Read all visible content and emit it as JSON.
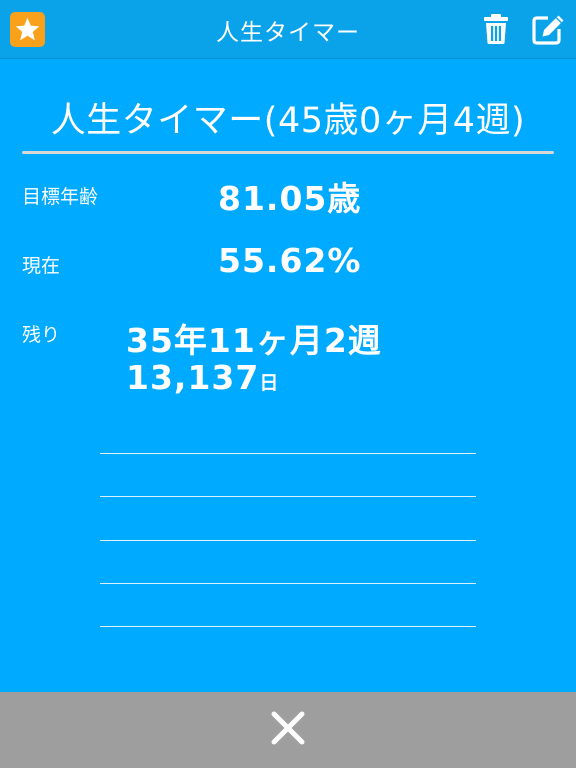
{
  "navbar": {
    "title": "人生タイマー",
    "favorite_icon": "star-icon",
    "delete_icon": "trash-icon",
    "edit_icon": "edit-icon"
  },
  "header": {
    "title": "人生タイマー(45歳0ヶ月4週)"
  },
  "stats": {
    "target_age_label": "目標年齢",
    "target_age_value": "81.05歳",
    "current_label": "現在",
    "current_value": "55.62%",
    "remaining_label": "残り",
    "remaining_ymw": "35年11ヶ月2週",
    "remaining_days_number": "13,137",
    "remaining_days_unit": "日"
  },
  "bottom": {
    "close_icon": "close-icon"
  },
  "colors": {
    "background": "#00aaff",
    "navbar": "#0aa3ea",
    "favorite": "#f9a11b",
    "bottom_bar": "#9e9e9e"
  }
}
